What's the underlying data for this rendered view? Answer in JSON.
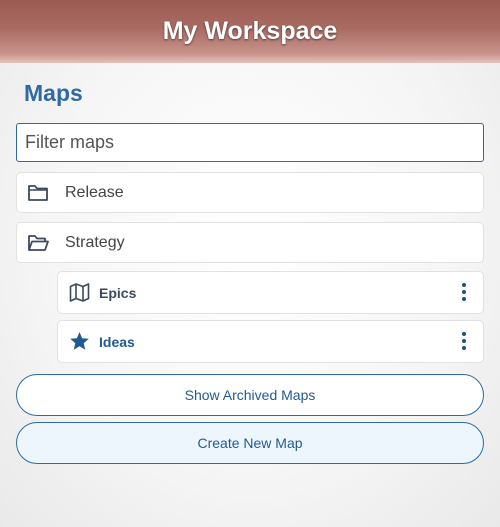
{
  "header": {
    "title": "My Workspace"
  },
  "section": {
    "title": "Maps"
  },
  "filter": {
    "placeholder": "Filter maps",
    "value": ""
  },
  "folders": [
    {
      "label": "Release",
      "icon": "folder-closed-icon"
    },
    {
      "label": "Strategy",
      "icon": "folder-open-icon"
    }
  ],
  "maps": [
    {
      "label": "Epics",
      "icon": "map-icon",
      "label_color": "#3d4a5c"
    },
    {
      "label": "Ideas",
      "icon": "star-icon",
      "label_color": "#1f5a94"
    }
  ],
  "buttons": {
    "show_archived": "Show Archived Maps",
    "create_new": "Create New Map"
  },
  "colors": {
    "accent": "#2f6aa5",
    "header": "#a96b62",
    "kebab": "#1f4e80",
    "create_bg": "#eef6fd"
  }
}
